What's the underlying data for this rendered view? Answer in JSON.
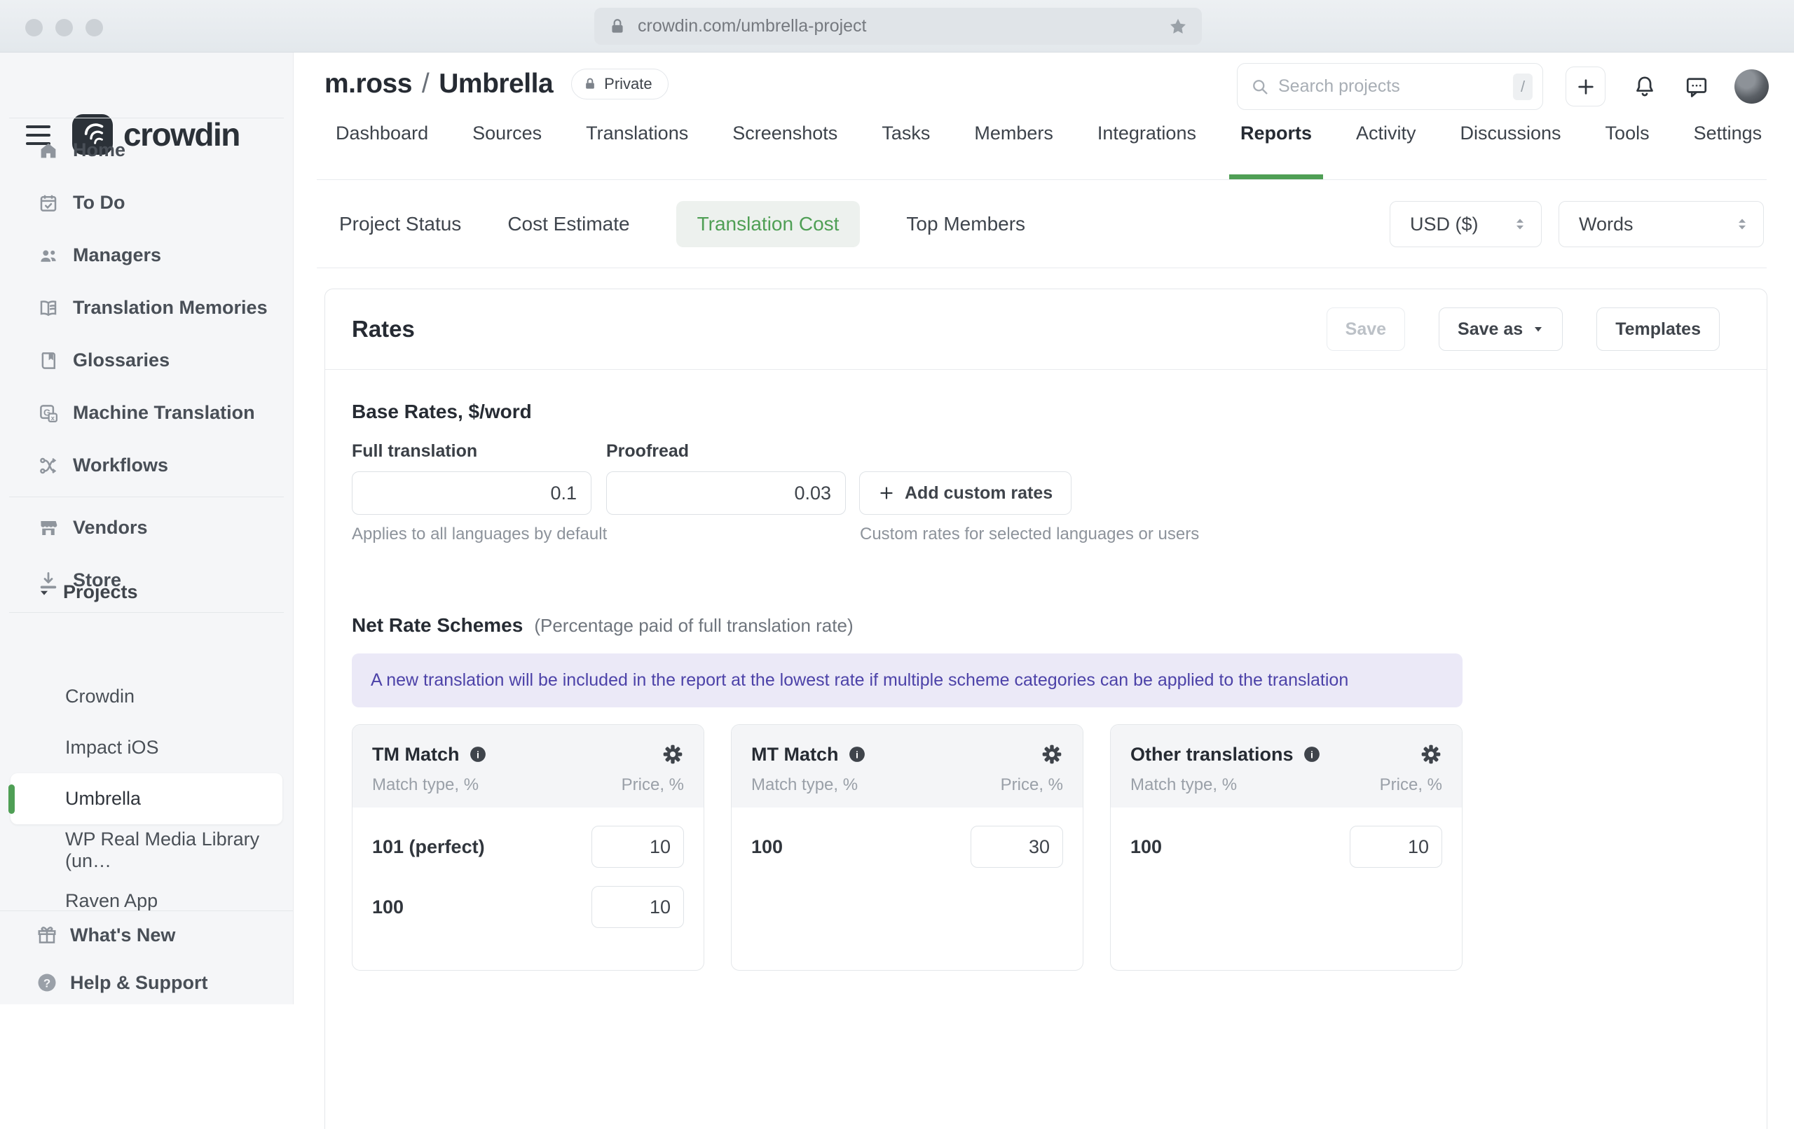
{
  "colors": {
    "accent_green": "#4f9f55",
    "pill_bg": "#edf1ee",
    "banner_bg": "#ebe9f7",
    "banner_text": "#4c42a8"
  },
  "browser": {
    "url": "crowdin.com/umbrella-project"
  },
  "sidebar": {
    "logo_text": "crowdin",
    "nav": [
      "Home",
      "To Do",
      "Managers",
      "Translation Memories",
      "Glossaries",
      "Machine Translation",
      "Workflows"
    ],
    "nav2": [
      "Vendors",
      "Store"
    ],
    "projects_label": "Projects",
    "projects": [
      "Crowdin",
      "Impact iOS",
      "Umbrella",
      "WP Real Media Library (un…",
      "Raven App"
    ],
    "footer": [
      "What's New",
      "Help & Support"
    ]
  },
  "header": {
    "owner": "m.ross",
    "separator": "/",
    "project": "Umbrella",
    "private_badge": "Private",
    "search": {
      "placeholder": "Search projects",
      "shortcut": "/"
    },
    "tabs": [
      "Dashboard",
      "Sources",
      "Translations",
      "Screenshots",
      "Tasks",
      "Members",
      "Integrations",
      "Reports",
      "Activity",
      "Discussions",
      "Tools",
      "Settings"
    ],
    "active_tab": "Reports"
  },
  "subtabs": {
    "items": [
      "Project Status",
      "Cost Estimate",
      "Translation Cost",
      "Top Members"
    ],
    "active": "Translation Cost"
  },
  "filters": {
    "currency": "USD ($)",
    "unit": "Words"
  },
  "rates": {
    "title": "Rates",
    "save_label": "Save",
    "save_as_label": "Save as",
    "templates_label": "Templates",
    "base": {
      "title": "Base Rates, $/word",
      "fields": [
        {
          "label": "Full translation",
          "value": "0.1"
        },
        {
          "label": "Proofread",
          "value": "0.03"
        }
      ],
      "add_custom_label": "Add custom rates",
      "help_left": "Applies to all languages by default",
      "help_right": "Custom rates for selected languages or users"
    },
    "net": {
      "title": "Net Rate Schemes",
      "subtitle": "(Percentage paid of full translation rate)",
      "banner": "A new translation will be included in the report at the lowest rate if multiple scheme categories can be applied to the translation",
      "cards": [
        {
          "title": "TM Match",
          "col_type": "Match type, %",
          "col_price": "Price, %",
          "rows": [
            {
              "label": "101 (perfect)",
              "value": "10"
            },
            {
              "label": "100",
              "value": "10"
            }
          ]
        },
        {
          "title": "MT Match",
          "col_type": "Match type, %",
          "col_price": "Price, %",
          "rows": [
            {
              "label": "100",
              "value": "30"
            }
          ]
        },
        {
          "title": "Other translations",
          "col_type": "Match type, %",
          "col_price": "Price, %",
          "rows": [
            {
              "label": "100",
              "value": "10"
            }
          ]
        }
      ]
    }
  }
}
